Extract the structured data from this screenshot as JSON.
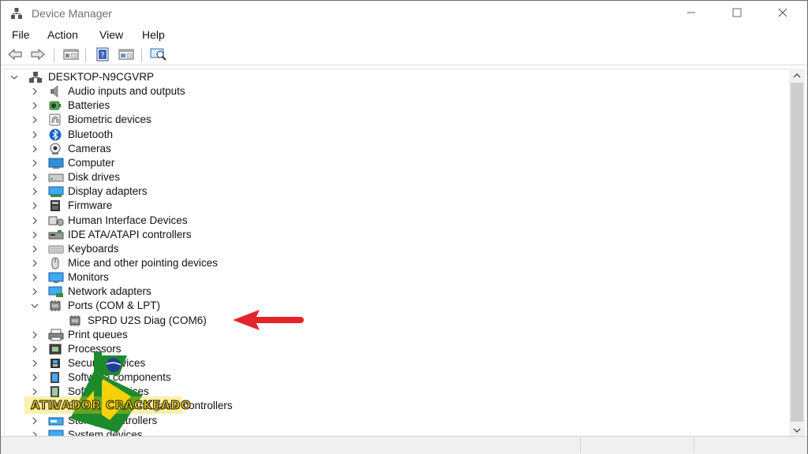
{
  "window": {
    "title": "Device Manager"
  },
  "titlebar": {
    "minimize_icon": "minimize-icon",
    "maximize_icon": "maximize-icon",
    "close_icon": "close-icon"
  },
  "menu": {
    "items": [
      "File",
      "Action",
      "View",
      "Help"
    ]
  },
  "toolbar": {
    "icons": [
      "back-arrow-icon",
      "forward-arrow-icon",
      "show-hide-console-tree-icon",
      "properties-icon",
      "update-driver-icon",
      "scan-hardware-icon"
    ]
  },
  "tree": {
    "root": "DESKTOP-N9CGVRP",
    "categories": [
      {
        "label": "Audio inputs and outputs",
        "icon": "speaker-icon"
      },
      {
        "label": "Batteries",
        "icon": "battery-icon"
      },
      {
        "label": "Biometric devices",
        "icon": "fingerprint-icon"
      },
      {
        "label": "Bluetooth",
        "icon": "bluetooth-icon"
      },
      {
        "label": "Cameras",
        "icon": "camera-icon"
      },
      {
        "label": "Computer",
        "icon": "computer-icon"
      },
      {
        "label": "Disk drives",
        "icon": "disk-drive-icon"
      },
      {
        "label": "Display adapters",
        "icon": "display-adapter-icon"
      },
      {
        "label": "Firmware",
        "icon": "firmware-icon"
      },
      {
        "label": "Human Interface Devices",
        "icon": "hid-icon"
      },
      {
        "label": "IDE ATA/ATAPI controllers",
        "icon": "ide-controller-icon"
      },
      {
        "label": "Keyboards",
        "icon": "keyboard-icon"
      },
      {
        "label": "Mice and other pointing devices",
        "icon": "mouse-icon"
      },
      {
        "label": "Monitors",
        "icon": "monitor-icon"
      },
      {
        "label": "Network adapters",
        "icon": "network-adapter-icon"
      },
      {
        "label": "Ports (COM & LPT)",
        "icon": "port-icon",
        "expanded": true
      },
      {
        "label": "SPRD U2S Diag (COM6)",
        "icon": "port-device-icon",
        "child": true
      },
      {
        "label": "Print queues",
        "icon": "printer-icon"
      },
      {
        "label": "Processors",
        "icon": "processor-icon"
      },
      {
        "label": "Security devices",
        "icon": "security-icon"
      },
      {
        "label": "Software components",
        "icon": "software-component-icon"
      },
      {
        "label": "Software devices",
        "icon": "software-device-icon"
      },
      {
        "label": "Sound, video and game controllers",
        "icon": "sound-icon"
      },
      {
        "label": "Storage controllers",
        "icon": "storage-icon"
      },
      {
        "label": "System devices",
        "icon": "system-device-icon"
      }
    ]
  },
  "watermark": {
    "text": "ATIVADOR CRACKEADO"
  },
  "colors": {
    "arrow": "#e5232b",
    "tree_icon_blue": "#3a7fc8",
    "watermark_green": "#1d8a2c",
    "watermark_yellow": "#f5d10a"
  }
}
